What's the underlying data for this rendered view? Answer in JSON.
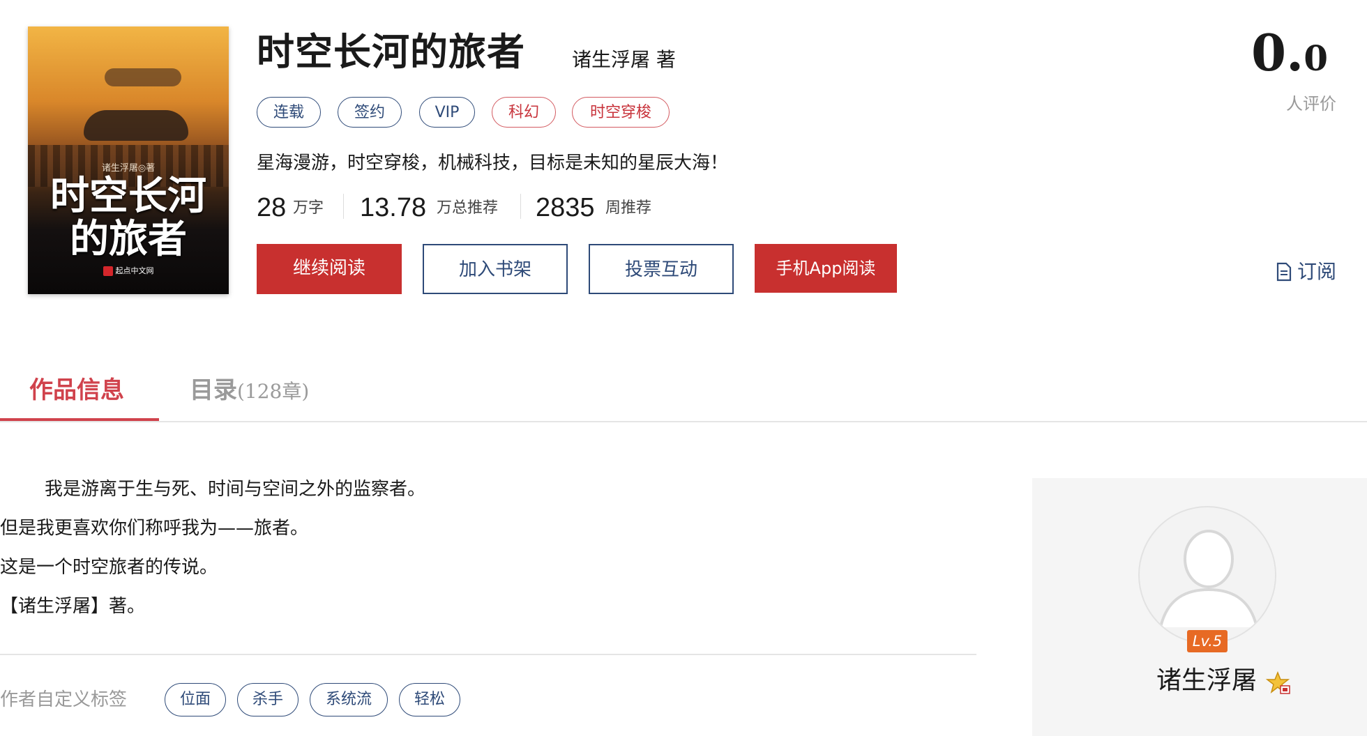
{
  "book": {
    "cover": {
      "author_line": "诸生浮屠◎著",
      "title_line1": "时空长河",
      "title_line2": "的旅者",
      "brand": "起点中文网"
    },
    "title": "时空长河的旅者",
    "author_text": "诸生浮屠 著",
    "tags": [
      {
        "label": "连载",
        "style": "blue"
      },
      {
        "label": "签约",
        "style": "blue"
      },
      {
        "label": "VIP",
        "style": "blue"
      },
      {
        "label": "科幻",
        "style": "red"
      },
      {
        "label": "时空穿梭",
        "style": "red"
      }
    ],
    "intro": "星海漫游，时空穿梭，机械科技，目标是未知的星辰大海！",
    "stats": [
      {
        "value": "28",
        "label": "万字"
      },
      {
        "value": "13.78",
        "label": "万总推荐"
      },
      {
        "value": "2835",
        "label": "周推荐"
      }
    ],
    "buttons": {
      "continue": "继续阅读",
      "bookshelf": "加入书架",
      "vote": "投票互动",
      "app": "手机App阅读"
    },
    "score": {
      "int": "0.",
      "dec": "0",
      "label": "人评价"
    },
    "subscribe": "订阅"
  },
  "tabs": [
    {
      "label": "作品信息"
    },
    {
      "label": "目录",
      "count": "(128章)"
    }
  ],
  "description": [
    "我是游离于生与死、时间与空间之外的监察者。",
    "但是我更喜欢你们称呼我为——旅者。",
    "这是一个时空旅者的传说。",
    "【诸生浮屠】著。"
  ],
  "custom_tags": {
    "label": "作者自定义标签",
    "items": [
      "位面",
      "杀手",
      "系统流",
      "轻松"
    ]
  },
  "author_card": {
    "level": "Lv.5",
    "name": "诸生浮屠",
    "badge": "star-badge-icon"
  },
  "colors": {
    "accent_red": "#c8302f",
    "tab_red": "#d0424c",
    "navy": "#2e4a78",
    "level_orange": "#e76a24"
  }
}
